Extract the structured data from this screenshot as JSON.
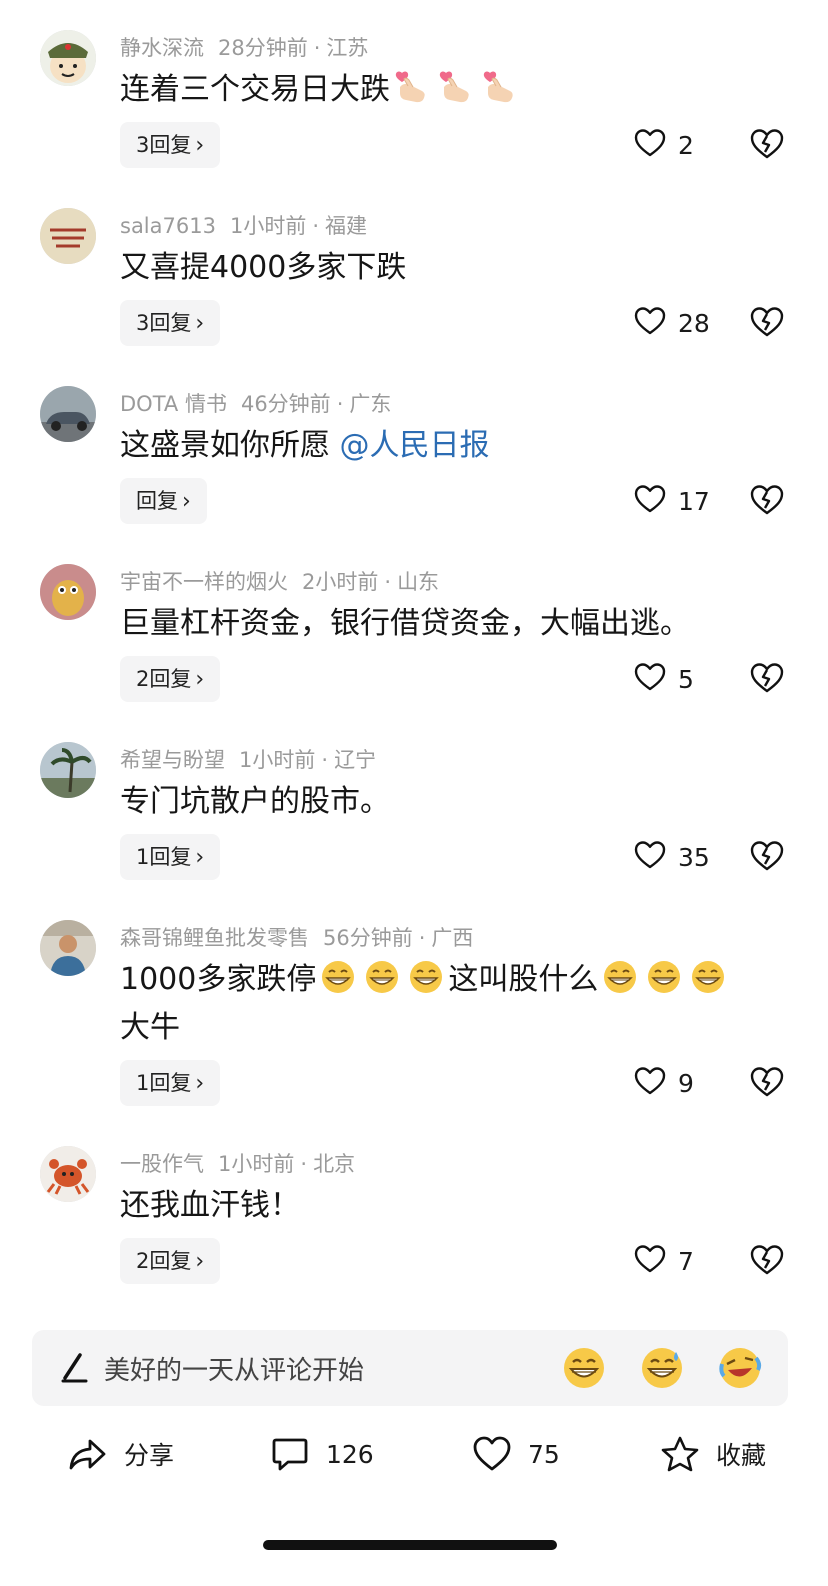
{
  "comments": [
    {
      "user": "静水深流",
      "time": "28分钟前",
      "location": "江苏",
      "text_before": "连着三个交易日大跌",
      "text_after": "",
      "mention": "",
      "replies": "3回复",
      "likes": "2",
      "emoji": "finger-heart"
    },
    {
      "user": "sala7613",
      "time": "1小时前",
      "location": "福建",
      "text_before": "又喜提4000多家下跌",
      "text_after": "",
      "mention": "",
      "replies": "3回复",
      "likes": "28"
    },
    {
      "user": "DOTA 情书",
      "time": "46分钟前",
      "location": "广东",
      "text_before": "这盛景如你所愿 ",
      "text_after": "",
      "mention": "@人民日报",
      "replies": "回复",
      "likes": "17"
    },
    {
      "user": "宇宙不一样的烟火",
      "time": "2小时前",
      "location": "山东",
      "text_before": "巨量杠杆资金，银行借贷资金，大幅出逃。",
      "text_after": "",
      "mention": "",
      "replies": "2回复",
      "likes": "5"
    },
    {
      "user": "希望与盼望",
      "time": "1小时前",
      "location": "辽宁",
      "text_before": "专门坑散户的股市。",
      "text_after": "",
      "mention": "",
      "replies": "1回复",
      "likes": "35"
    },
    {
      "user": "森哥锦鲤鱼批发零售",
      "time": "56分钟前",
      "location": "广西",
      "text_before": "1000多家跌停",
      "text_middle": "这叫股什么",
      "text_after": "大牛",
      "mention": "",
      "replies": "1回复",
      "likes": "9",
      "emoji": "grin"
    },
    {
      "user": "一股作气",
      "time": "1小时前",
      "location": "北京",
      "text_before": "还我血汗钱！",
      "text_after": "",
      "mention": "",
      "replies": "2回复",
      "likes": "7"
    }
  ],
  "input_bar": {
    "placeholder": "美好的一天从评论开始",
    "quick_emojis": [
      "grin-emoji",
      "sweat-grin-emoji",
      "laugh-cry-emoji"
    ]
  },
  "action_bar": {
    "share": "分享",
    "comments": "126",
    "likes": "75",
    "favorite": "收藏"
  },
  "colors": {
    "mention": "#2b6cb3",
    "meta": "#9a9a9a",
    "chip_bg": "#f4f4f5",
    "heart_pink": "#f06a8a",
    "emoji_yellow": "#f7c948"
  }
}
